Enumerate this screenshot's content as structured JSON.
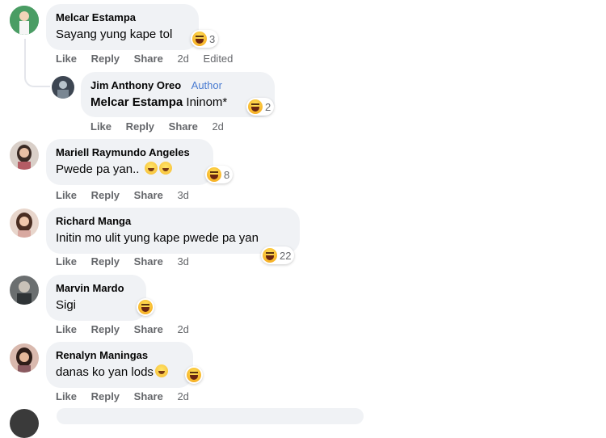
{
  "actions": {
    "like": "Like",
    "reply": "Reply",
    "share": "Share"
  },
  "author_badge": "Author",
  "colors": {
    "bubble": "#f0f2f5",
    "meta": "#65676b",
    "author": "#4a7cd1"
  },
  "comments": [
    {
      "name": "Melcar Estampa",
      "text": "Sayang yung kape tol",
      "reactions": "3",
      "time": "2d",
      "edited": "Edited",
      "avatar": "avatar-green"
    },
    {
      "name": "Jim Anthony Oreo",
      "mention": "Melcar Estampa",
      "text": " Ininom*",
      "reactions": "2",
      "time": "2d",
      "avatar": "avatar-dark"
    },
    {
      "name": "Mariell Raymundo Angeles",
      "text": "Pwede pa yan..",
      "reactions": "8",
      "time": "3d",
      "avatar": "avatar-woman"
    },
    {
      "name": "Richard Manga",
      "text": "Initin mo ulit yung kape pwede pa yan",
      "reactions": "22",
      "time": "3d",
      "avatar": "avatar-woman-2"
    },
    {
      "name": "Marvin Mardo",
      "text": "Sigi",
      "reactions": "",
      "time": "2d",
      "avatar": "avatar-gray"
    },
    {
      "name": "Renalyn Maningas",
      "text": "danas ko yan lods",
      "reactions": "",
      "time": "2d",
      "avatar": "avatar-woman-3"
    }
  ]
}
